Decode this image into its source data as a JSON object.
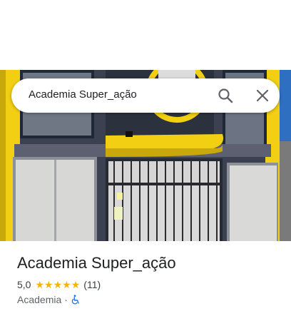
{
  "search": {
    "query": "Academia Super_ação"
  },
  "place": {
    "name": "Academia Super_ação",
    "rating": "5,0",
    "stars": [
      "★",
      "★",
      "★",
      "★",
      "★"
    ],
    "reviews": "(11)",
    "category": "Academia",
    "separator": "·"
  },
  "icons": {
    "search": "search-icon",
    "close": "close-icon",
    "accessibility": "wheelchair-icon"
  },
  "colors": {
    "star": "#f4b400",
    "accent_yellow": "#f6d20a",
    "accessibility_blue": "#1a73e8"
  }
}
